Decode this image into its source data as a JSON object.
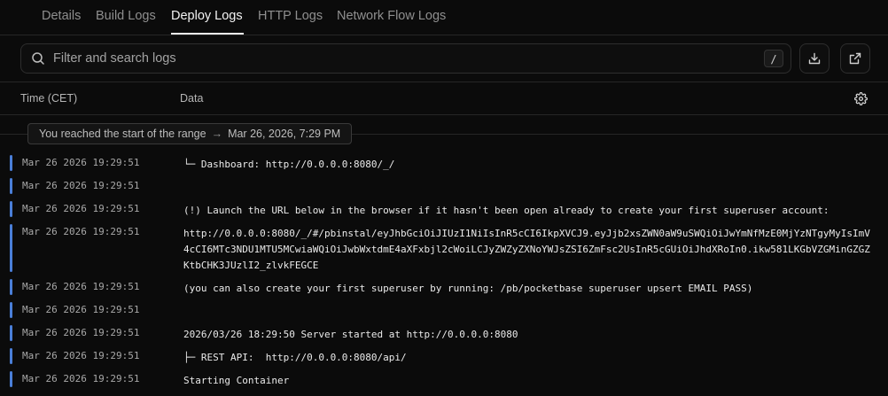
{
  "tabs": [
    {
      "label": "Details"
    },
    {
      "label": "Build Logs"
    },
    {
      "label": "Deploy Logs"
    },
    {
      "label": "HTTP Logs"
    },
    {
      "label": "Network Flow Logs"
    }
  ],
  "active_tab": "Deploy Logs",
  "search": {
    "placeholder": "Filter and search logs",
    "shortcut": "/",
    "icon": "search-icon"
  },
  "toolbar": {
    "download_icon": "download-icon",
    "open_external_icon": "external-link-icon"
  },
  "columns": {
    "time": "Time (CET)",
    "data": "Data",
    "settings_icon": "gear-icon"
  },
  "range_notice": {
    "text": "You reached the start of the range",
    "arrow": "→",
    "timestamp": "Mar 26, 2026, 7:29 PM"
  },
  "accent_color": "#4a7fd9",
  "logs": [
    {
      "time": "Mar 26 2026 19:29:51",
      "message": "└─ Dashboard: http://0.0.0.0:8080/_/"
    },
    {
      "time": "Mar 26 2026 19:29:51",
      "message": ""
    },
    {
      "time": "Mar 26 2026 19:29:51",
      "message": "(!) Launch the URL below in the browser if it hasn't been open already to create your first superuser account:"
    },
    {
      "time": "Mar 26 2026 19:29:51",
      "message": "http://0.0.0.0:8080/_/#/pbinstal/eyJhbGciOiJIUzI1NiIsInR5cCI6IkpXVCJ9.eyJjb2xsZWN0aW9uSWQiOiJwYmNfMzE0MjYzNTgyMyIsImV4cCI6MTc3NDU1MTU5MCwiaWQiOiJwbWxtdmE4aXFxbjl2cWoiLCJyZWZyZXNoYWJsZSI6ZmFsc2UsInR5cGUiOiJhdXRoIn0.ikw581LKGbVZGMinGZGZKtbCHK3JUzlI2_zlvkFEGCE"
    },
    {
      "time": "Mar 26 2026 19:29:51",
      "message": "(you can also create your first superuser by running: /pb/pocketbase superuser upsert EMAIL PASS)"
    },
    {
      "time": "Mar 26 2026 19:29:51",
      "message": ""
    },
    {
      "time": "Mar 26 2026 19:29:51",
      "message": "2026/03/26 18:29:50 Server started at http://0.0.0.0:8080"
    },
    {
      "time": "Mar 26 2026 19:29:51",
      "message": "├─ REST API:  http://0.0.0.0:8080/api/"
    },
    {
      "time": "Mar 26 2026 19:29:51",
      "message": "Starting Container"
    }
  ]
}
